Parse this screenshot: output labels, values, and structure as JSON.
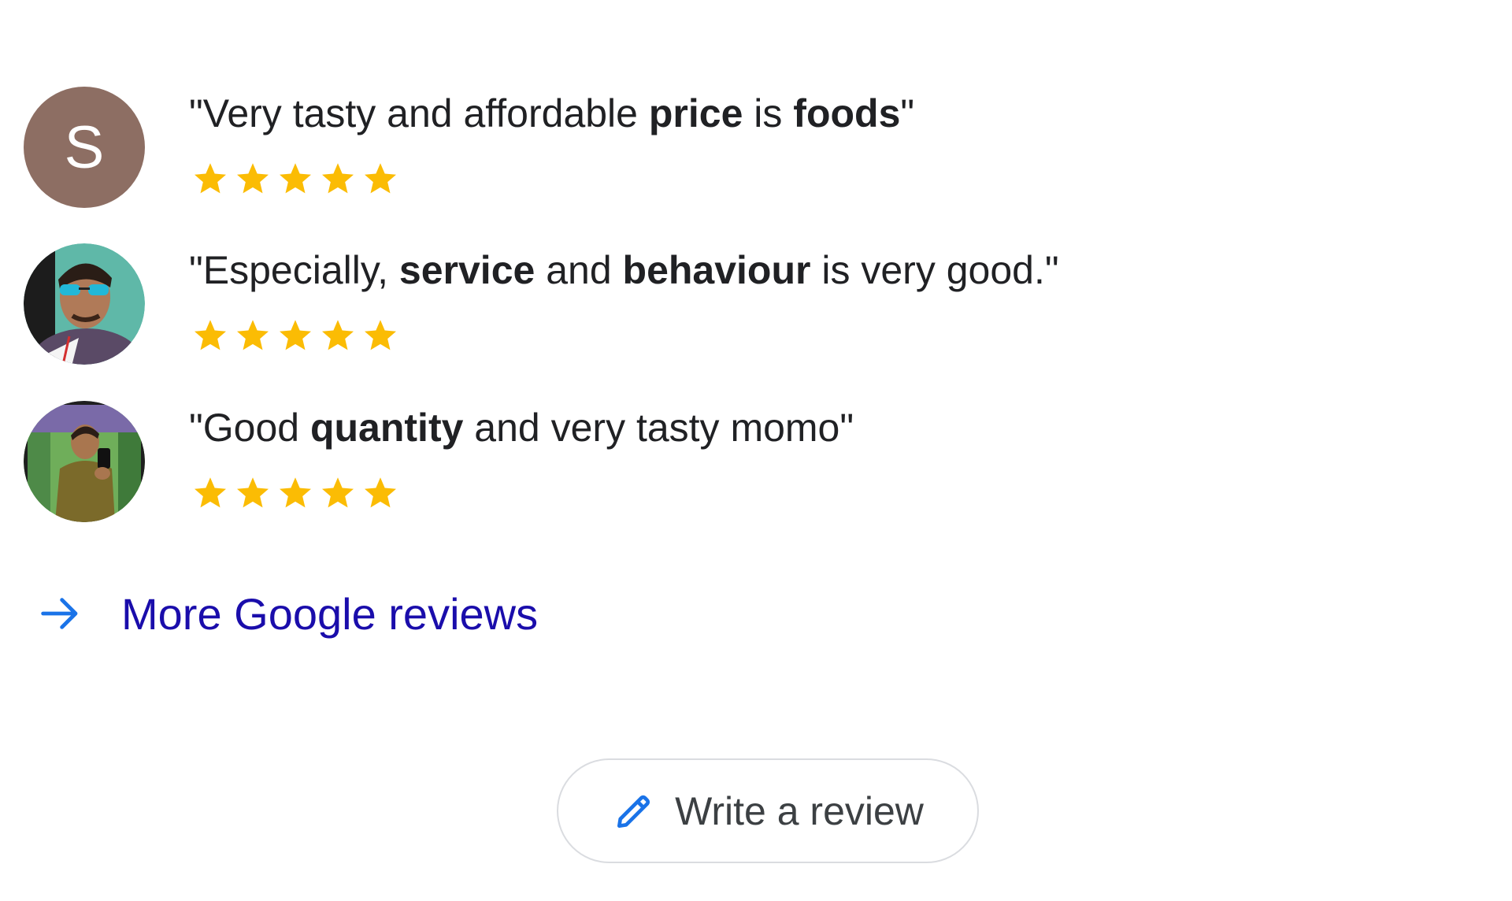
{
  "reviews": [
    {
      "avatar": {
        "kind": "letter",
        "letter": "S",
        "color": "#8d6e63"
      },
      "quote_parts": [
        {
          "text": "\"Very tasty and affordable ",
          "bold": false
        },
        {
          "text": "price",
          "bold": true
        },
        {
          "text": " is ",
          "bold": false
        },
        {
          "text": "foods",
          "bold": true
        },
        {
          "text": "\"",
          "bold": false
        }
      ],
      "rating": 5
    },
    {
      "avatar": {
        "kind": "photo",
        "icon": "user-photo-sunglasses"
      },
      "quote_parts": [
        {
          "text": "\"Especially, ",
          "bold": false
        },
        {
          "text": "service",
          "bold": true
        },
        {
          "text": " and ",
          "bold": false
        },
        {
          "text": "behaviour",
          "bold": true
        },
        {
          "text": " is very good.\"",
          "bold": false
        }
      ],
      "rating": 5
    },
    {
      "avatar": {
        "kind": "photo",
        "icon": "user-photo-mirror-selfie"
      },
      "quote_parts": [
        {
          "text": "\"Good ",
          "bold": false
        },
        {
          "text": "quantity",
          "bold": true
        },
        {
          "text": " and very tasty momo\"",
          "bold": false
        }
      ],
      "rating": 5
    }
  ],
  "more_reviews": {
    "label": "More Google reviews",
    "icon": "arrow-right-icon",
    "color": "#1a0dab",
    "icon_color": "#1a73e8"
  },
  "write_review": {
    "label": "Write a review",
    "icon": "pencil-icon",
    "icon_color": "#1a73e8"
  },
  "colors": {
    "star": "#fbbc04",
    "text": "#202124",
    "border": "#dadce0"
  }
}
